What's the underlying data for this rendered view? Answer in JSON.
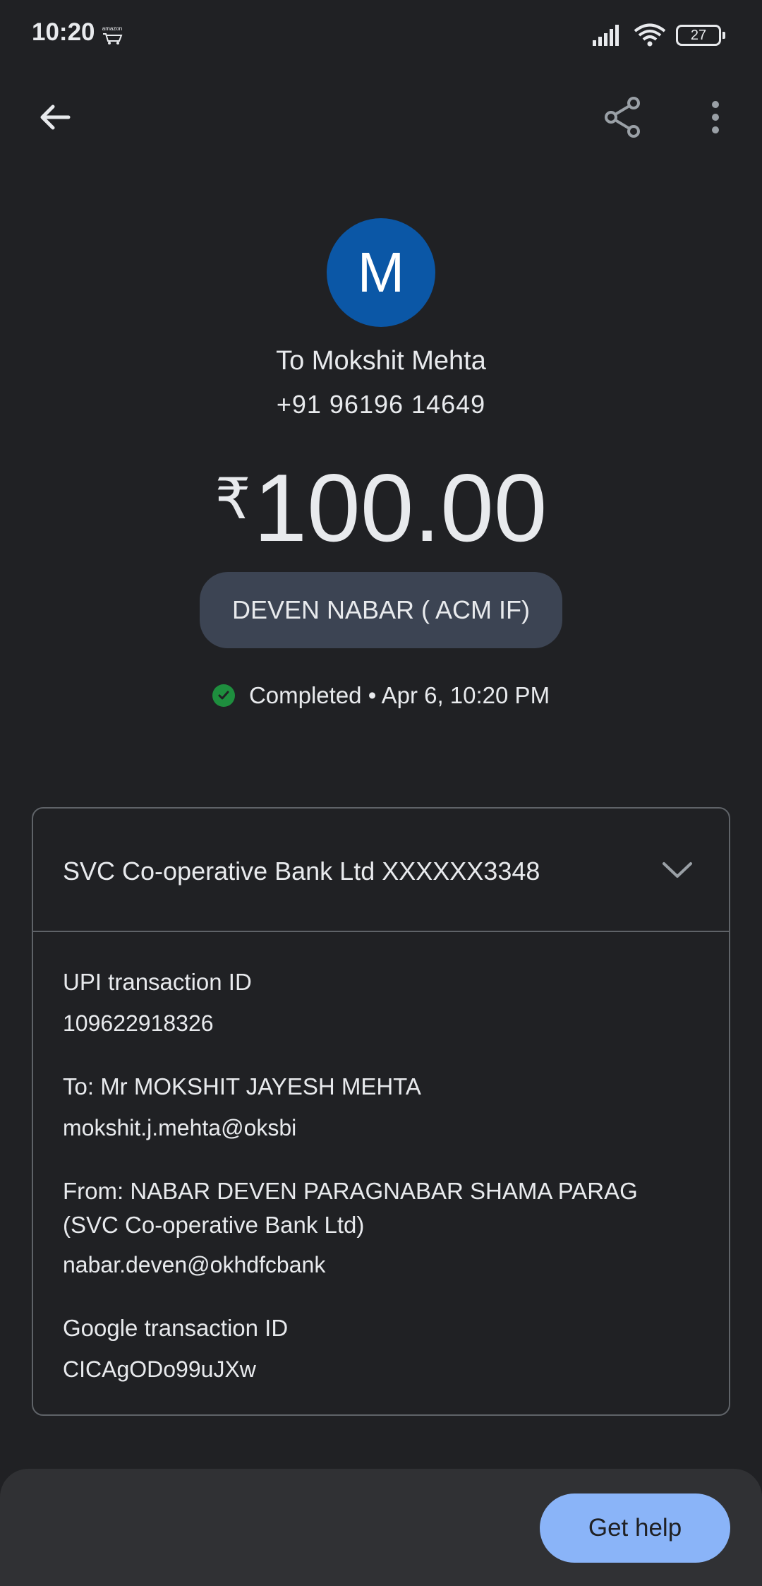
{
  "status_bar": {
    "time": "10:20",
    "notification_label": "amazon",
    "battery": "27"
  },
  "top_bar": {
    "back_icon": "arrow-back-icon",
    "share_icon": "share-icon",
    "more_icon": "more-vert-icon"
  },
  "recipient": {
    "avatar_letter": "M",
    "avatar_color": "#0b57a6",
    "name": "To Mokshit Mehta",
    "phone": "+91 96196 14649"
  },
  "payment": {
    "currency": "₹",
    "amount": "100.00",
    "note": "DEVEN NABAR ( ACM IF)",
    "status": "Completed • Apr 6, 10:20 PM",
    "status_color": "#1e8e3e"
  },
  "details": {
    "bank": "SVC Co-operative Bank Ltd XXXXXX3348",
    "upi_label": "UPI transaction ID",
    "upi_value": "109622918326",
    "to_label": "To: Mr MOKSHIT JAYESH MEHTA",
    "to_value": "mokshit.j.mehta@oksbi",
    "from_label": "From: NABAR DEVEN PARAGNABAR SHAMA PARAG (SVC Co-operative Bank Ltd)",
    "from_value": "nabar.deven@okhdfcbank",
    "google_label": "Google transaction ID",
    "google_value": "CICAgODo99uJXw"
  },
  "footer": {
    "help_label": "Get help",
    "help_color": "#8ab4f8"
  }
}
